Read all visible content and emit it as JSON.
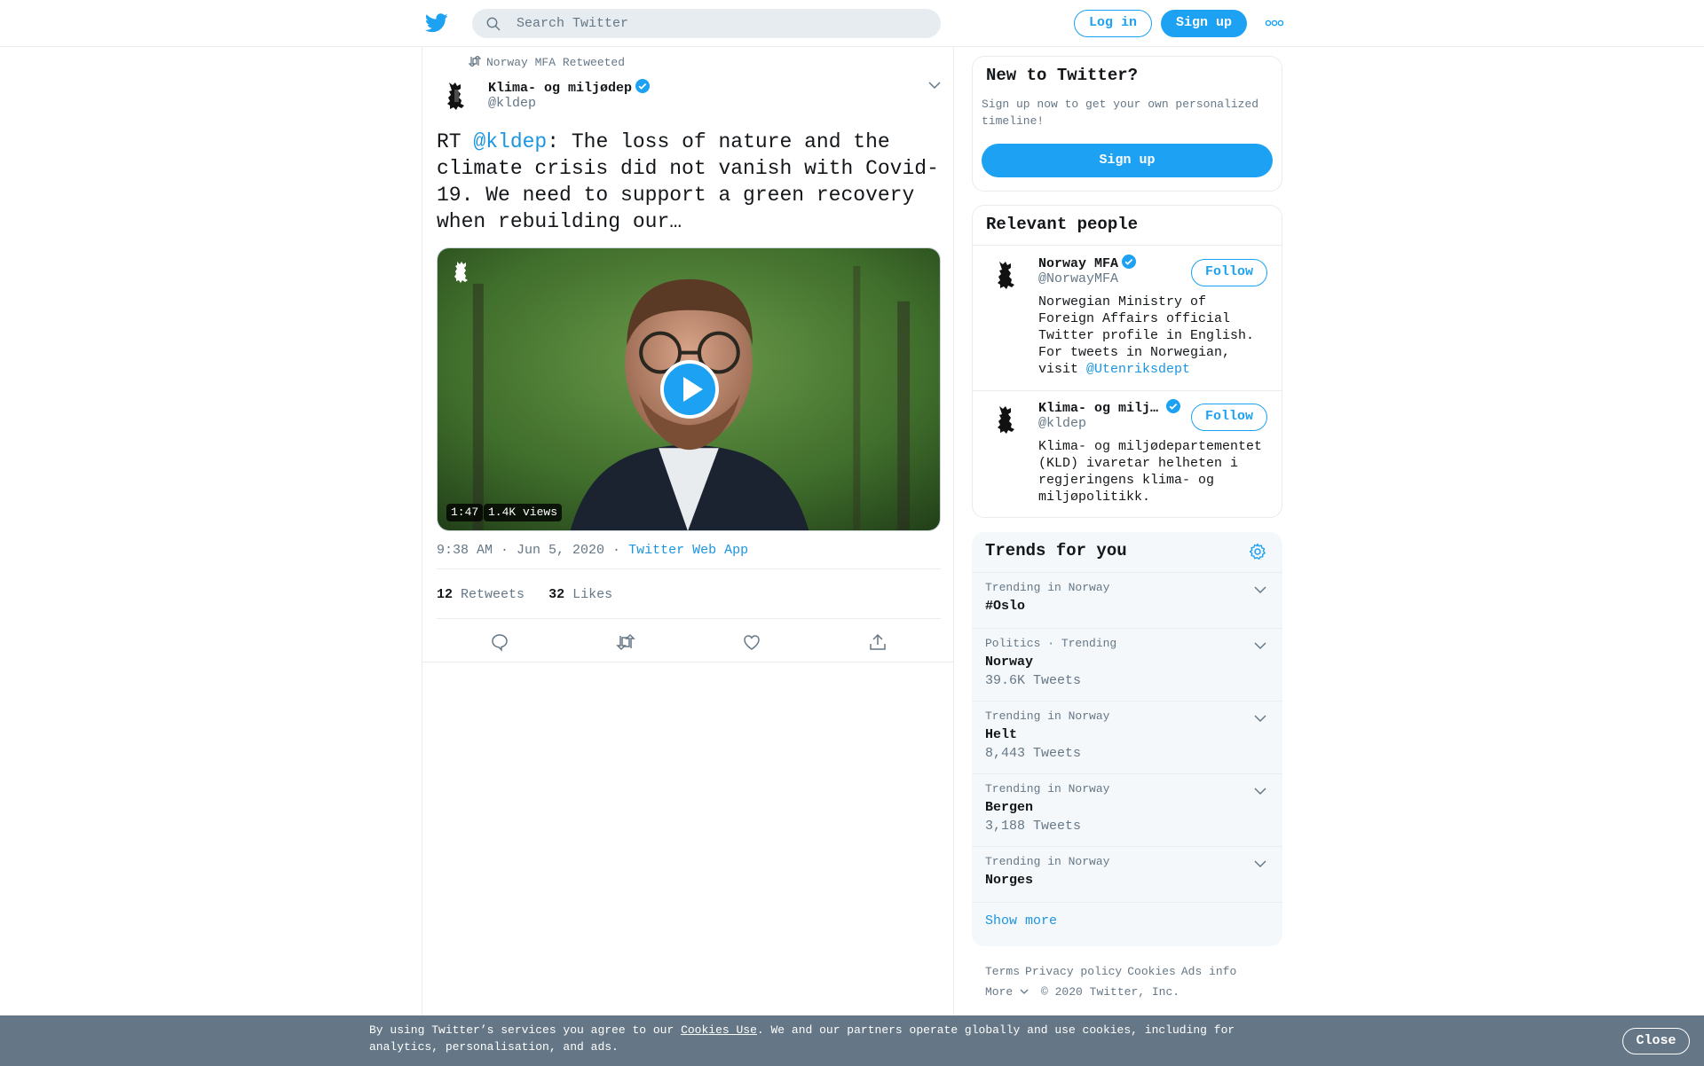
{
  "header": {
    "search_placeholder": "Search Twitter",
    "login_label": "Log in",
    "signup_label": "Sign up"
  },
  "tweet": {
    "retweeted_by": "Norway MFA Retweeted",
    "author_name": "Klima- og miljødep",
    "author_handle": "@kldep",
    "text_prefix": "RT ",
    "text_mention": "@kldep",
    "text_body": ": The loss of nature and the climate crisis did not vanish with Covid-19. We need to support a green recovery when rebuilding our…",
    "video_duration": "1:47",
    "video_views": "1.4K views",
    "timestamp": "9:38 AM · Jun 5, 2020 ·",
    "source": "Twitter Web App",
    "retweets_count": "12",
    "retweets_label": "Retweets",
    "likes_count": "32",
    "likes_label": "Likes"
  },
  "sidebar": {
    "new_to_twitter": {
      "title": "New to Twitter?",
      "description": "Sign up now to get your own personalized timeline!",
      "signup_label": "Sign up"
    },
    "relevant_people": {
      "title": "Relevant people",
      "people": [
        {
          "name": "Norway MFA",
          "handle": "@NorwayMFA",
          "bio": "Norwegian Ministry of Foreign Affairs official Twitter profile in English. For tweets in Norwegian, visit ",
          "bio_link": "@Utenriksdept",
          "follow_label": "Follow"
        },
        {
          "name": "Klima- og milj…",
          "handle": "@kldep",
          "bio": "Klima- og miljødepartementet (KLD) ivaretar helheten i regjeringens klima- og miljøpolitikk.",
          "follow_label": "Follow"
        }
      ]
    },
    "trends": {
      "title": "Trends for you",
      "items": [
        {
          "context": "Trending in Norway",
          "name": "#Oslo",
          "count": ""
        },
        {
          "context": "Politics · Trending",
          "name": "Norway",
          "count": "39.6K Tweets"
        },
        {
          "context": "Trending in Norway",
          "name": "Helt",
          "count": "8,443 Tweets"
        },
        {
          "context": "Trending in Norway",
          "name": "Bergen",
          "count": "3,188 Tweets"
        },
        {
          "context": "Trending in Norway",
          "name": "Norges",
          "count": ""
        }
      ],
      "show_more": "Show more"
    },
    "footer": {
      "links": [
        "Terms",
        "Privacy policy",
        "Cookies",
        "Ads info"
      ],
      "more": "More",
      "copyright": "© 2020 Twitter, Inc."
    }
  },
  "cookie_bar": {
    "text_before": "By using Twitter’s services you agree to our ",
    "link": "Cookies Use",
    "text_after": ". We and our partners operate globally and use cookies, including for analytics, personalisation, and ads.",
    "close_label": "Close"
  },
  "colors": {
    "brand": "#1da1f2",
    "link": "#1b95e0",
    "muted": "#657786",
    "cookie_bg": "#657786"
  }
}
